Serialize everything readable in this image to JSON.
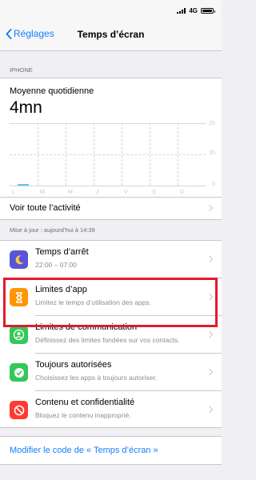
{
  "status": {
    "network": "4G"
  },
  "nav": {
    "back_label": "Réglages",
    "title": "Temps d’écran"
  },
  "usage": {
    "section_label": "IPHONE",
    "average_label": "Moyenne quotidienne",
    "average_value": "4mn",
    "y_labels": [
      "2h",
      "1h",
      "0"
    ],
    "x_labels": [
      "L",
      "M",
      "M",
      "J",
      "V",
      "S",
      "D"
    ],
    "bar_value_fraction": 0.02,
    "activity_label": "Voir toute l’activité"
  },
  "update_label": "Mise à jour : aujourd’hui à 14:39",
  "items": [
    {
      "title": "Temps d’arrêt",
      "subtitle": "22:00 – 07:00",
      "icon": "moon-icon",
      "color": "#5856d6"
    },
    {
      "title": "Limites d’app",
      "subtitle": "Limitez le temps d’utilisation des apps.",
      "icon": "hourglass-icon",
      "color": "#ff9500"
    },
    {
      "title": "Limites de communication",
      "subtitle": "Définissez des limites fondées sur vos contacts.",
      "icon": "contact-icon",
      "color": "#34c759"
    },
    {
      "title": "Toujours autorisées",
      "subtitle": "Choisissez les apps à toujours autoriser.",
      "icon": "checkmark-icon",
      "color": "#34c759"
    },
    {
      "title": "Contenu et confidentialité",
      "subtitle": "Bloquez le contenu inapproprié.",
      "icon": "block-icon",
      "color": "#ff3b30"
    }
  ],
  "footer": {
    "link_label": "Modifier le code de « Temps d’écran »"
  }
}
